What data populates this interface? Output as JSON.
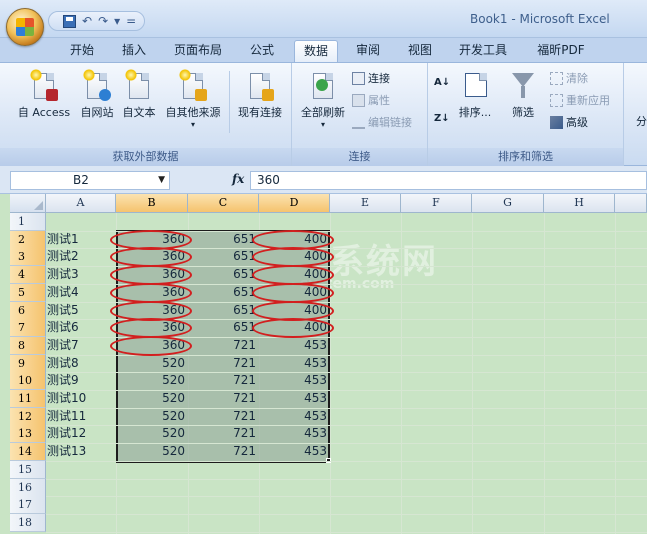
{
  "window": {
    "title": "Book1 - Microsoft Excel"
  },
  "quick_access": {
    "undo": "↶",
    "redo": "↷",
    "print": "▾",
    "more": "="
  },
  "ribbon_tabs": [
    {
      "label": "开始"
    },
    {
      "label": "插入"
    },
    {
      "label": "页面布局"
    },
    {
      "label": "公式"
    },
    {
      "label": "数据",
      "active": true
    },
    {
      "label": "审阅"
    },
    {
      "label": "视图"
    },
    {
      "label": "开发工具"
    },
    {
      "label": "福昕PDF"
    }
  ],
  "groups": {
    "external": {
      "label": "获取外部数据",
      "buttons": [
        "自 Access",
        "自网站",
        "自文本",
        "自其他来源",
        "现有连接"
      ]
    },
    "connections": {
      "label": "连接",
      "refresh": "全部刷新",
      "items": [
        "连接",
        "属性",
        "编辑链接"
      ]
    },
    "sort_filter": {
      "label": "排序和筛选",
      "sort": "排序...",
      "filter": "筛选",
      "items": [
        "清除",
        "重新应用",
        "高级"
      ]
    },
    "more": {
      "label": "分"
    }
  },
  "formula_bar": {
    "name_box": "B2",
    "fx": "fx",
    "content": "360"
  },
  "columns": [
    "A",
    "B",
    "C",
    "D",
    "E",
    "F",
    "G",
    "H"
  ],
  "rows": [
    {
      "n": "1",
      "a": "",
      "b": "",
      "c": "",
      "d": ""
    },
    {
      "n": "2",
      "a": "测试1",
      "b": "360",
      "c": "651",
      "d": "400"
    },
    {
      "n": "3",
      "a": "测试2",
      "b": "360",
      "c": "651",
      "d": "400"
    },
    {
      "n": "4",
      "a": "测试3",
      "b": "360",
      "c": "651",
      "d": "400"
    },
    {
      "n": "5",
      "a": "测试4",
      "b": "360",
      "c": "651",
      "d": "400"
    },
    {
      "n": "6",
      "a": "测试5",
      "b": "360",
      "c": "651",
      "d": "400"
    },
    {
      "n": "7",
      "a": "测试6",
      "b": "360",
      "c": "651",
      "d": "400"
    },
    {
      "n": "8",
      "a": "测试7",
      "b": "360",
      "c": "721",
      "d": "453"
    },
    {
      "n": "9",
      "a": "测试8",
      "b": "520",
      "c": "721",
      "d": "453"
    },
    {
      "n": "10",
      "a": "测试9",
      "b": "520",
      "c": "721",
      "d": "453"
    },
    {
      "n": "11",
      "a": "测试10",
      "b": "520",
      "c": "721",
      "d": "453"
    },
    {
      "n": "12",
      "a": "测试11",
      "b": "520",
      "c": "721",
      "d": "453"
    },
    {
      "n": "13",
      "a": "测试12",
      "b": "520",
      "c": "721",
      "d": "453"
    },
    {
      "n": "14",
      "a": "测试13",
      "b": "520",
      "c": "721",
      "d": "453"
    },
    {
      "n": "15",
      "a": "",
      "b": "",
      "c": "",
      "d": ""
    },
    {
      "n": "16",
      "a": "",
      "b": "",
      "c": "",
      "d": ""
    },
    {
      "n": "17",
      "a": "",
      "b": "",
      "c": "",
      "d": ""
    },
    {
      "n": "18",
      "a": "",
      "b": "",
      "c": "",
      "d": ""
    }
  ],
  "selection": {
    "range": "B2:D14",
    "active_cell": "B2"
  },
  "highlight_color": "#d21f1f",
  "sheet_color": "#c9e4c5"
}
